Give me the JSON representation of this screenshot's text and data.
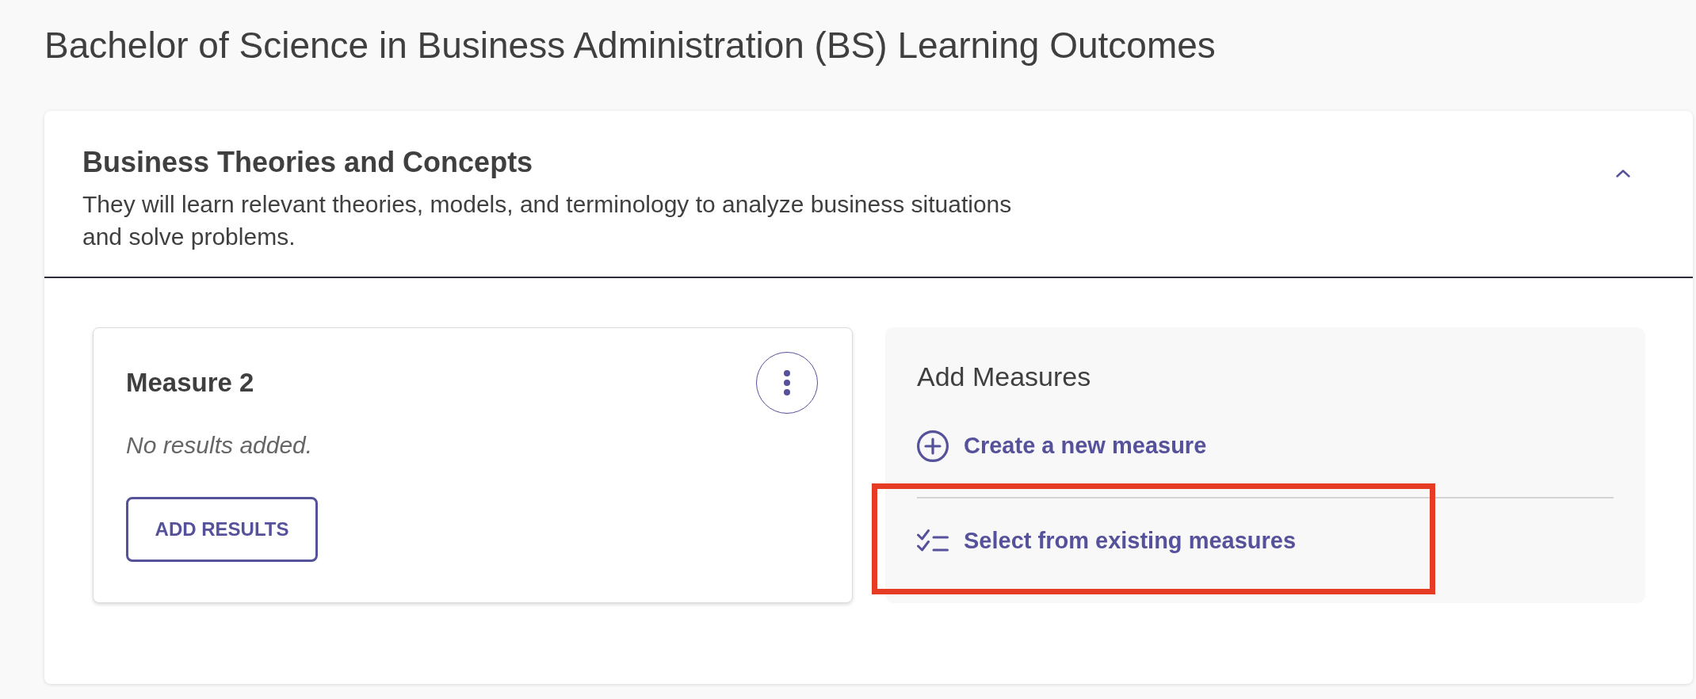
{
  "page": {
    "title": "Bachelor of Science in Business Administration (BS) Learning Outcomes"
  },
  "outcome": {
    "title": "Business Theories and Concepts",
    "description": "They will learn relevant theories, models, and terminology to analyze business situations and solve problems.",
    "expanded": true,
    "measures": [
      {
        "title": "Measure 2",
        "status": "No results added.",
        "action": "ADD RESULTS"
      }
    ],
    "add_measures": {
      "title": "Add Measures",
      "options": [
        {
          "kind": "create",
          "label": "Create a new measure",
          "highlighted": false
        },
        {
          "kind": "select",
          "label": "Select from existing measures",
          "highlighted": true
        }
      ]
    }
  }
}
